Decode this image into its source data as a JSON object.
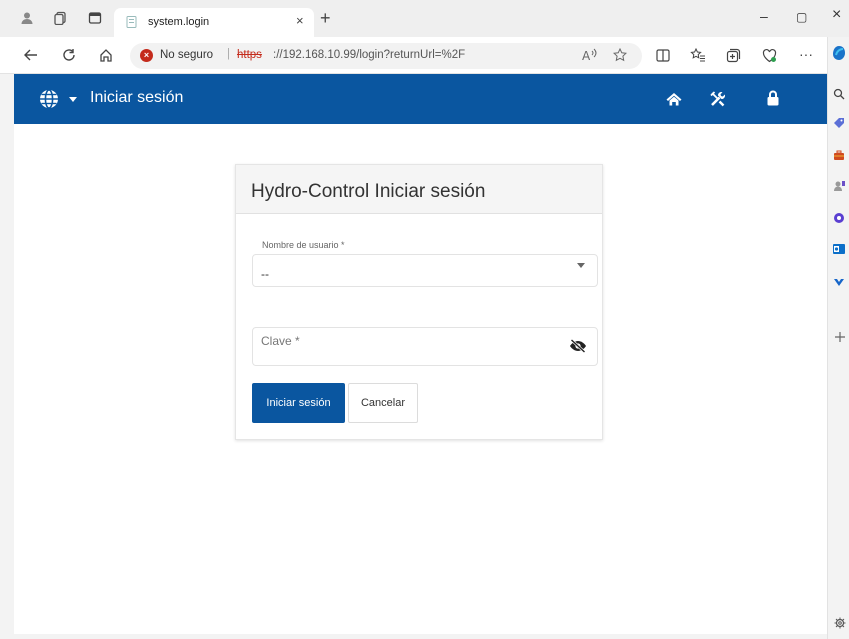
{
  "browser": {
    "tab_title": "system.login",
    "tab_close": "×",
    "new_tab": "+",
    "minimize": "–",
    "maximize": "▢",
    "close": "×",
    "security_label": "No seguro",
    "separator": "|",
    "url_scheme": "https",
    "url_rest": "://192.168.10.99/login?returnUrl=%2F",
    "more": "···"
  },
  "app": {
    "title": "Iniciar sesión",
    "accent": "#0a56a0"
  },
  "login": {
    "card_title": "Hydro-Control Iniciar sesión",
    "username_label": "Nombre de usuario *",
    "username_value": "--",
    "password_label": "Clave *",
    "login_button": "Iniciar sesión",
    "cancel_button": "Cancelar"
  }
}
